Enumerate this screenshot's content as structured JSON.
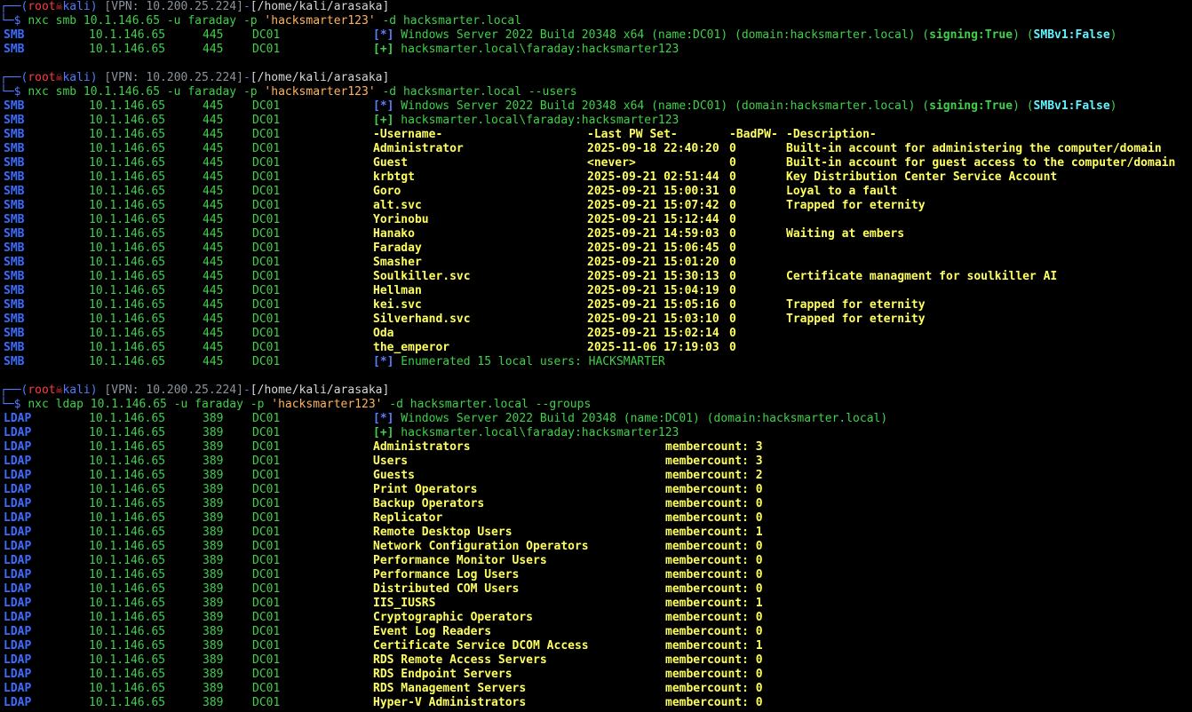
{
  "prompts": [
    {
      "root": "root",
      "skull": "☠",
      "host": "kali",
      "vpn": "[VPN: 10.200.25.224]",
      "path": "[/home/kali/arasaka]",
      "cmd_pre": "nxc smb 10.1.146.65 -u faraday -p ",
      "cmd_quoted": "'hacksmarter123'",
      "cmd_post": " -d hacksmarter.local"
    },
    {
      "root": "root",
      "skull": "☠",
      "host": "kali",
      "vpn": "[VPN: 10.200.25.224]",
      "path": "[/home/kali/arasaka]",
      "cmd_pre": "nxc smb 10.1.146.65 -u faraday -p ",
      "cmd_quoted": "'hacksmarter123'",
      "cmd_post": " -d hacksmarter.local --users"
    },
    {
      "root": "root",
      "skull": "☠",
      "host": "kali",
      "vpn": "[VPN: 10.200.25.224]",
      "path": "[/home/kali/arasaka]",
      "cmd_pre": "nxc ldap 10.1.146.65 -u faraday -p ",
      "cmd_quoted": "'hacksmarter123'",
      "cmd_post": " -d hacksmarter.local --groups"
    }
  ],
  "prompt_corner_top": "┌──(",
  "prompt_corner_bottom": "└─$ ",
  "target": {
    "ip": "10.1.146.65",
    "smb_port": "445",
    "ldap_port": "389",
    "name": "DC01",
    "smb_proto": "SMB",
    "ldap_proto": "LDAP"
  },
  "smb_banner": {
    "star": "[*]",
    "text": " Windows Server 2022 Build 20348 x64 (name:DC01) (domain:hacksmarter.local) (",
    "signing": "signing:True",
    "mid": ") (",
    "smbv1": "SMBv1:False",
    "end": ")"
  },
  "smb_auth": {
    "plus": "[+]",
    "text": " hacksmarter.local\\faraday:hacksmarter123"
  },
  "users_header": {
    "username": "-Username-",
    "lastpw": "-Last PW Set-",
    "badpw": "-BadPW-",
    "desc": "-Description-"
  },
  "users": [
    {
      "username": "Administrator",
      "lastpw": "2025-09-18 22:40:20",
      "badpw": "0",
      "desc": "Built-in account for administering the computer/domain"
    },
    {
      "username": "Guest",
      "lastpw": "<never>",
      "badpw": "0",
      "desc": "Built-in account for guest access to the computer/domain"
    },
    {
      "username": "krbtgt",
      "lastpw": "2025-09-21 02:51:44",
      "badpw": "0",
      "desc": "Key Distribution Center Service Account"
    },
    {
      "username": "Goro",
      "lastpw": "2025-09-21 15:00:31",
      "badpw": "0",
      "desc": "Loyal to a fault"
    },
    {
      "username": "alt.svc",
      "lastpw": "2025-09-21 15:07:42",
      "badpw": "0",
      "desc": "Trapped for eternity"
    },
    {
      "username": "Yorinobu",
      "lastpw": "2025-09-21 15:12:44",
      "badpw": "0",
      "desc": ""
    },
    {
      "username": "Hanako",
      "lastpw": "2025-09-21 14:59:03",
      "badpw": "0",
      "desc": "Waiting at embers"
    },
    {
      "username": "Faraday",
      "lastpw": "2025-09-21 15:06:45",
      "badpw": "0",
      "desc": ""
    },
    {
      "username": "Smasher",
      "lastpw": "2025-09-21 15:01:20",
      "badpw": "0",
      "desc": ""
    },
    {
      "username": "Soulkiller.svc",
      "lastpw": "2025-09-21 15:30:13",
      "badpw": "0",
      "desc": "Certificate managment for soulkiller AI"
    },
    {
      "username": "Hellman",
      "lastpw": "2025-09-21 15:04:19",
      "badpw": "0",
      "desc": ""
    },
    {
      "username": "kei.svc",
      "lastpw": "2025-09-21 15:05:16",
      "badpw": "0",
      "desc": "Trapped for eternity"
    },
    {
      "username": "Silverhand.svc",
      "lastpw": "2025-09-21 15:03:10",
      "badpw": "0",
      "desc": "Trapped for eternity"
    },
    {
      "username": "Oda",
      "lastpw": "2025-09-21 15:02:14",
      "badpw": "0",
      "desc": ""
    },
    {
      "username": "the_emperor",
      "lastpw": "2025-11-06 17:19:03",
      "badpw": "0",
      "desc": ""
    }
  ],
  "users_summary": {
    "star": "[*]",
    "text": " Enumerated 15 local users: HACKSMARTER"
  },
  "ldap_banner": {
    "star": "[*]",
    "text": " Windows Server 2022 Build 20348 (name:DC01) (domain:hacksmarter.local)"
  },
  "ldap_auth": {
    "plus": "[+]",
    "text": " hacksmarter.local\\faraday:hacksmarter123"
  },
  "groups": [
    {
      "name": "Administrators",
      "count": "membercount: 3"
    },
    {
      "name": "Users",
      "count": "membercount: 3"
    },
    {
      "name": "Guests",
      "count": "membercount: 2"
    },
    {
      "name": "Print Operators",
      "count": "membercount: 0"
    },
    {
      "name": "Backup Operators",
      "count": "membercount: 0"
    },
    {
      "name": "Replicator",
      "count": "membercount: 0"
    },
    {
      "name": "Remote Desktop Users",
      "count": "membercount: 1"
    },
    {
      "name": "Network Configuration Operators",
      "count": "membercount: 0"
    },
    {
      "name": "Performance Monitor Users",
      "count": "membercount: 0"
    },
    {
      "name": "Performance Log Users",
      "count": "membercount: 0"
    },
    {
      "name": "Distributed COM Users",
      "count": "membercount: 0"
    },
    {
      "name": "IIS_IUSRS",
      "count": "membercount: 1"
    },
    {
      "name": "Cryptographic Operators",
      "count": "membercount: 0"
    },
    {
      "name": "Event Log Readers",
      "count": "membercount: 0"
    },
    {
      "name": "Certificate Service DCOM Access",
      "count": "membercount: 1"
    },
    {
      "name": "RDS Remote Access Servers",
      "count": "membercount: 0"
    },
    {
      "name": "RDS Endpoint Servers",
      "count": "membercount: 0"
    },
    {
      "name": "RDS Management Servers",
      "count": "membercount: 0"
    },
    {
      "name": "Hyper-V Administrators",
      "count": "membercount: 0"
    }
  ]
}
